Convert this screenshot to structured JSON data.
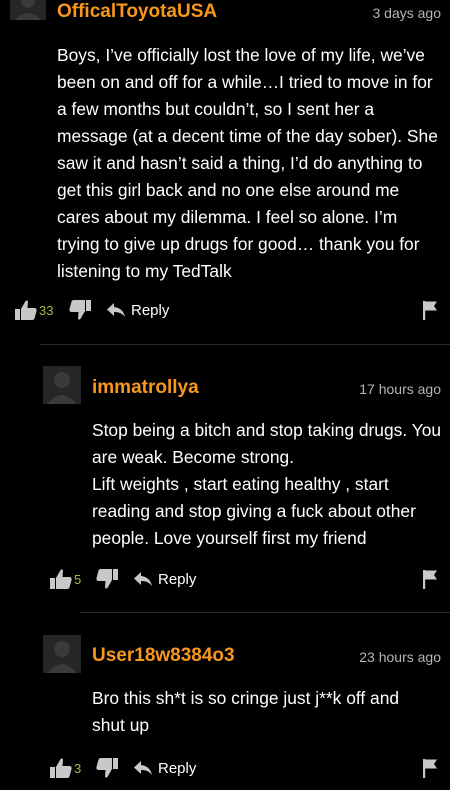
{
  "comments": [
    {
      "username": "OfficalToyotaUSA",
      "timestamp": "3 days ago",
      "paragraphs": [
        "Boys, I’ve officially lost the love of my life, we’ve been on and off for a while…I tried to move in for a few months but couldn’t, so I sent her a message (at a decent time of the day sober). She saw it and hasn’t said a thing, I’d do anything to get this girl back and no one else around me cares about my dilemma. I feel so alone. I’m trying to give up drugs for good… thank you for listening to my TedTalk"
      ],
      "upvotes": "33",
      "reply_label": "Reply",
      "icons": {
        "upvote": "thumbs-up-icon",
        "downvote": "thumbs-down-icon",
        "reply": "reply-arrow-icon",
        "flag": "flag-icon"
      }
    },
    {
      "username": "immatrollya",
      "timestamp": "17 hours ago",
      "paragraphs": [
        "Stop being a bitch and stop taking drugs. You are weak. Become strong.",
        "Lift weights , start eating healthy , start reading and stop giving a fuck about other people. Love yourself first my friend"
      ],
      "upvotes": "5",
      "reply_label": "Reply",
      "icons": {
        "upvote": "thumbs-up-icon",
        "downvote": "thumbs-down-icon",
        "reply": "reply-arrow-icon",
        "flag": "flag-icon"
      }
    },
    {
      "username": "User18w8384o3",
      "timestamp": "23 hours ago",
      "paragraphs": [
        "Bro this sh*t is so cringe just j**k off and shut up"
      ],
      "upvotes": "3",
      "reply_label": "Reply",
      "icons": {
        "upvote": "thumbs-up-icon",
        "downvote": "thumbs-down-icon",
        "reply": "reply-arrow-icon",
        "flag": "flag-icon"
      }
    }
  ],
  "colors": {
    "background": "#000000",
    "username": "#f7971d",
    "timestamp": "#b5b5b5",
    "upvote_count": "#9bbf4a",
    "icon": "#c8c8c8",
    "divider": "#2b2b2b"
  }
}
